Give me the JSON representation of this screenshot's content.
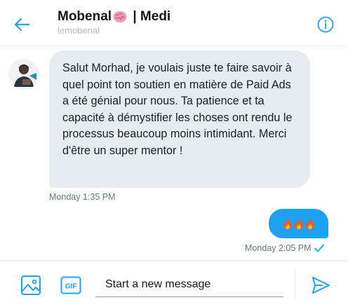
{
  "header": {
    "title_name": "Mobenal",
    "title_suffix": " | Medi",
    "handle": "lemobenal",
    "brain_icon": "brain-emoji-icon",
    "back_icon": "arrow-left-icon",
    "info_icon": "info-circle-icon"
  },
  "messages": [
    {
      "direction": "incoming",
      "text": "Salut Morhad, je voulais juste te faire savoir à quel point ton soutien en matière de Paid Ads a été génial pour nous. Ta patience et ta capacité à démystifier les choses ont rendu le processus beaucoup moins intimidant. Merci d'être un super mentor !",
      "timestamp": "Monday 1:35 PM"
    },
    {
      "direction": "outgoing",
      "content_icons": [
        "fire-emoji-icon",
        "fire-emoji-icon",
        "fire-emoji-icon"
      ],
      "timestamp": "Monday 2:05 PM",
      "status_icon": "check-icon"
    }
  ],
  "composer": {
    "placeholder": "Start a new message",
    "value": "",
    "media_icon": "image-icon",
    "gif_icon": "gif-icon",
    "gif_label": "GIF",
    "send_icon": "send-icon"
  },
  "colors": {
    "accent": "#1da1f2",
    "incoming_bubble": "#e6ecf0",
    "muted_text": "#657786"
  }
}
